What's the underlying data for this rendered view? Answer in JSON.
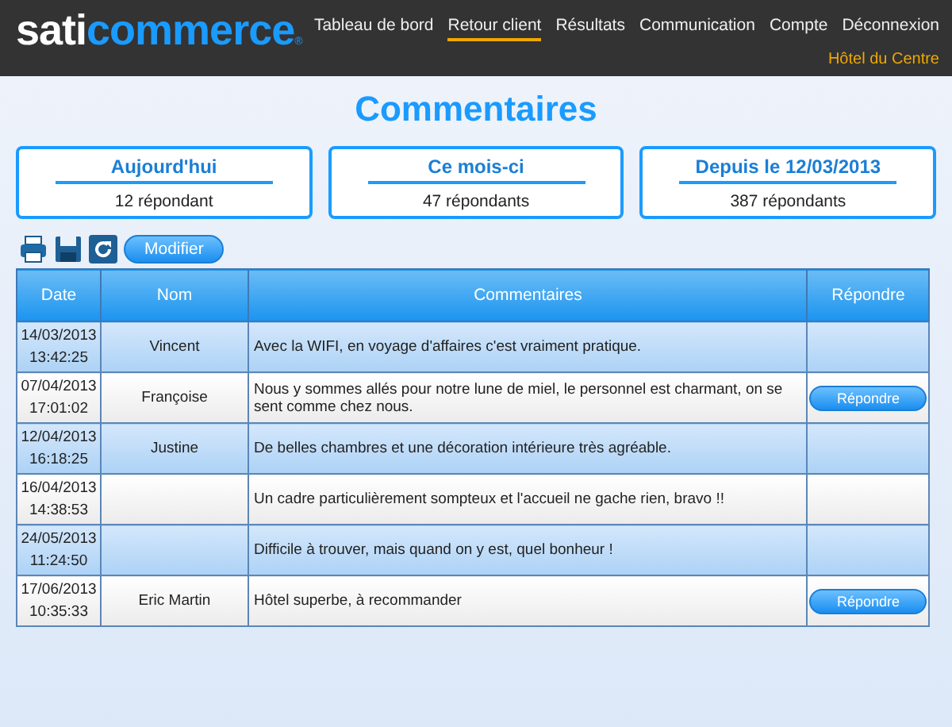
{
  "logo": {
    "first": "sati",
    "second": "commerce",
    "mark": "®"
  },
  "nav": [
    {
      "label": "Tableau de bord",
      "selected": false
    },
    {
      "label": "Retour client",
      "selected": true
    },
    {
      "label": "Résultats",
      "selected": false
    },
    {
      "label": "Communication",
      "selected": false
    },
    {
      "label": "Compte",
      "selected": false
    },
    {
      "label": "Déconnexion",
      "selected": false
    }
  ],
  "account": "Hôtel du Centre",
  "title": "Commentaires",
  "stats": [
    {
      "title": "Aujourd'hui",
      "value": "12 répondant"
    },
    {
      "title": "Ce mois-ci",
      "value": "47 répondants"
    },
    {
      "title": "Depuis le 12/03/2013",
      "value": "387 répondants"
    }
  ],
  "toolbar": {
    "button": "Modifier"
  },
  "table": {
    "columns": [
      "Date",
      "Nom",
      "Commentaires",
      "Répondre"
    ],
    "rows": [
      {
        "date": "14/03/2013",
        "time": "13:42:25",
        "name": "Vincent",
        "comment": "Avec la WIFI, en voyage d'affaires c'est vraiment pratique."
      },
      {
        "date": "07/04/2013",
        "time": "17:01:02",
        "name": "Françoise",
        "comment": "Nous y sommes allés pour notre lune de miel, le personnel est charmant, on se sent comme chez nous.",
        "reply": "Répondre"
      },
      {
        "date": "12/04/2013",
        "time": "16:18:25",
        "name": "Justine",
        "comment": "De belles chambres et une décoration intérieure très agréable."
      },
      {
        "date": "16/04/2013",
        "time": "14:38:53",
        "comment": "Un cadre particulièrement sompteux et l'accueil ne gache rien, bravo !!"
      },
      {
        "date": "24/05/2013",
        "time": "11:24:50",
        "comment": "Difficile à trouver, mais quand on y est, quel bonheur !"
      },
      {
        "date": "17/06/2013",
        "time": "10:35:33",
        "name": "Eric Martin",
        "comment": "Hôtel superbe, à recommander",
        "reply": "Répondre"
      }
    ]
  }
}
